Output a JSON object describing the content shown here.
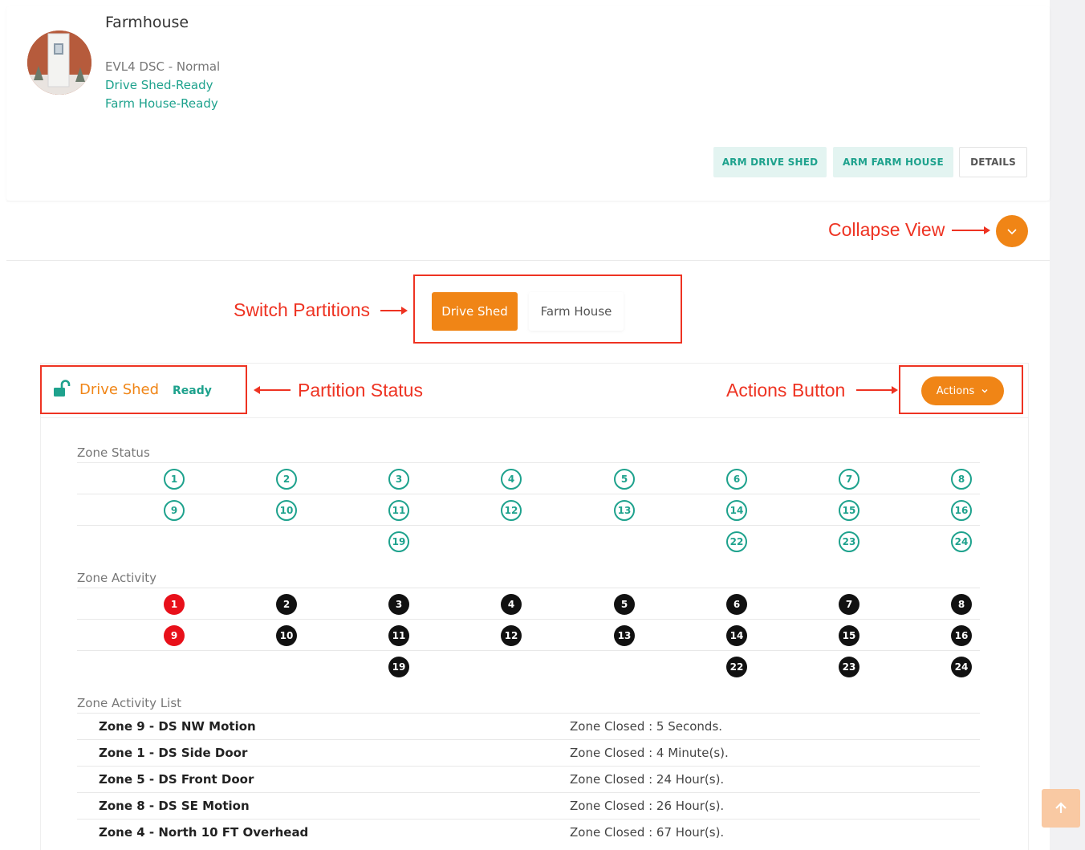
{
  "site": {
    "title": "Farmhouse",
    "status_lines": [
      "EVL4 DSC - Normal",
      "Drive Shed-Ready",
      "Farm House-Ready"
    ]
  },
  "top_buttons": {
    "arm1": "ARM DRIVE SHED",
    "arm2": "ARM FARM HOUSE",
    "details": "DETAILS"
  },
  "annotations": {
    "collapse": "Collapse View",
    "switch": "Switch Partitions",
    "status": "Partition Status",
    "actions": "Actions Button"
  },
  "partitions": {
    "tabs": [
      {
        "label": "Drive Shed",
        "active": true
      },
      {
        "label": "Farm House",
        "active": false
      }
    ]
  },
  "partition": {
    "name": "Drive Shed",
    "state": "Ready",
    "actions_label": "Actions"
  },
  "zone_status": {
    "label": "Zone Status",
    "rows": [
      [
        "1",
        "2",
        "3",
        "4",
        "5",
        "6",
        "7",
        "8"
      ],
      [
        "9",
        "10",
        "11",
        "12",
        "13",
        "14",
        "15",
        "16"
      ],
      [
        "",
        "",
        "19",
        "",
        "",
        "22",
        "23",
        "24"
      ]
    ]
  },
  "zone_activity": {
    "label": "Zone Activity",
    "rows": [
      [
        "1",
        "2",
        "3",
        "4",
        "5",
        "6",
        "7",
        "8"
      ],
      [
        "9",
        "10",
        "11",
        "12",
        "13",
        "14",
        "15",
        "16"
      ],
      [
        "",
        "",
        "19",
        "",
        "",
        "22",
        "23",
        "24"
      ]
    ],
    "alert_zones": [
      "1",
      "9"
    ]
  },
  "activity_list": {
    "label": "Zone Activity List",
    "items": [
      {
        "zone": "Zone 9 - DS NW Motion",
        "status": "Zone Closed : 5 Seconds."
      },
      {
        "zone": "Zone 1 - DS Side Door",
        "status": "Zone Closed : 4 Minute(s)."
      },
      {
        "zone": "Zone 5 - DS Front Door",
        "status": "Zone Closed : 24 Hour(s)."
      },
      {
        "zone": "Zone 8 - DS SE Motion",
        "status": "Zone Closed : 26 Hour(s)."
      },
      {
        "zone": "Zone 4 - North 10 FT Overhead",
        "status": "Zone Closed : 67 Hour(s)."
      }
    ]
  },
  "colors": {
    "accent": "#f08516",
    "teal": "#1ea28d",
    "annotation": "#ee3322",
    "alert": "#e8101a"
  },
  "icons": [
    "door-photo",
    "chevron-down-icon",
    "unlock-icon",
    "arrow-up-icon"
  ]
}
